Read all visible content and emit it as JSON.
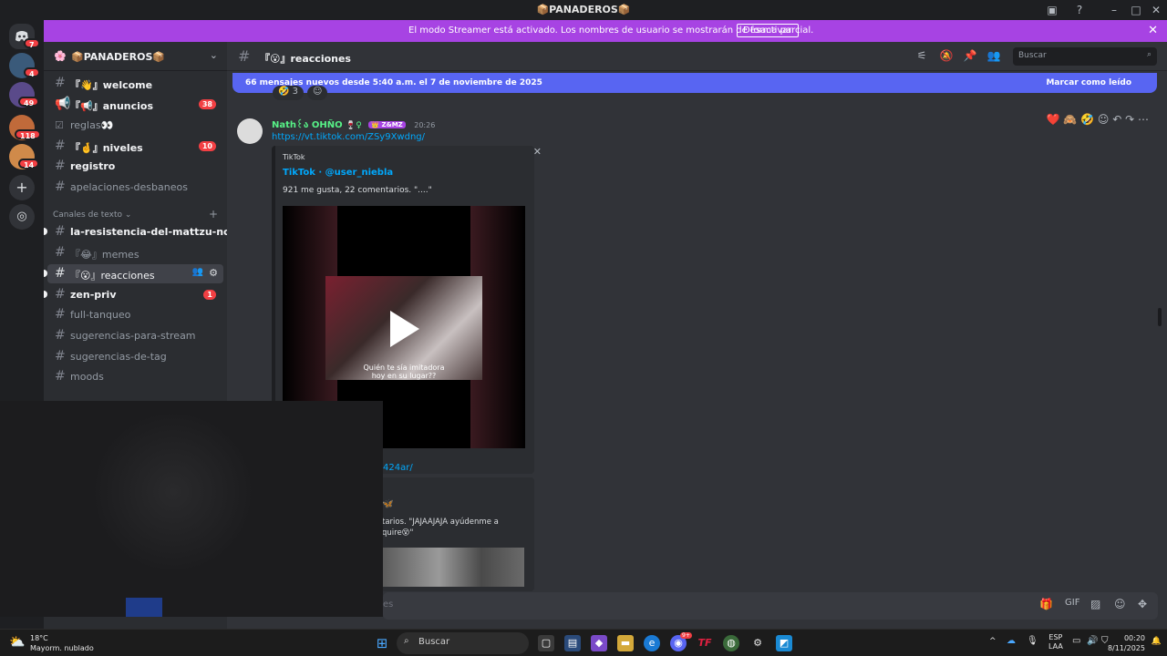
{
  "window": {
    "title": "📦PANADEROS📦"
  },
  "banner": {
    "text": "El modo Streamer está activado. Los nombres de usuario se mostrarán de forma parcial.",
    "button": "Desactivar"
  },
  "rail": {
    "badges": [
      "7",
      "4",
      "49",
      "118",
      "14"
    ]
  },
  "server": {
    "name": "📦PANADEROS📦"
  },
  "channels": [
    {
      "label": "『👋』welcome",
      "unread": true,
      "count": ""
    },
    {
      "label": "『📢』anuncios",
      "unread": true,
      "count": "38"
    },
    {
      "label": "reglas👀",
      "unread": false,
      "count": ""
    },
    {
      "label": "『🤞』niveles",
      "unread": true,
      "count": "10"
    },
    {
      "label": "registro",
      "unread": true,
      "count": ""
    },
    {
      "label": "apelaciones-desbaneos",
      "unread": false,
      "count": ""
    }
  ],
  "category": {
    "label": "Canales de texto"
  },
  "text_channels": [
    {
      "label": "la-resistencia-del-mattzu-no-s...",
      "unread": true,
      "count": ""
    },
    {
      "label": "『😂』memes",
      "unread": false,
      "count": ""
    },
    {
      "label": "『😮』reacciones",
      "unread": false,
      "count": "",
      "active": true
    },
    {
      "label": "zen-priv",
      "unread": true,
      "count": "1"
    },
    {
      "label": "full-tanqueo",
      "unread": false,
      "count": ""
    },
    {
      "label": "sugerencias-para-stream",
      "unread": false,
      "count": ""
    },
    {
      "label": "sugerencias-de-tag",
      "unread": false,
      "count": ""
    },
    {
      "label": "moods",
      "unread": false,
      "count": ""
    }
  ],
  "chat": {
    "channel_name": "『😮』reacciones",
    "search_placeholder": "Buscar",
    "new_messages": "66 mensajes nuevos desde 5:40 a.m. el 7 de noviembre de 2025",
    "mark_read": "Marcar como leído",
    "reaction_count": "3",
    "message": {
      "author": "Nath꒰ა OHÑO",
      "tag": "Z&MZ",
      "time": "20:26",
      "link": "https://vt.tiktok.com/ZSy9Xwdng/",
      "embed_provider": "TikTok",
      "embed_title": "TikTok · @user_niebla",
      "embed_desc": "921 me gusta, 22 comentarios. \"....\"",
      "video_caption_1": "Quién te sía imitadora",
      "video_caption_2": "hoy en su lugar??"
    },
    "message2": {
      "link_tail": "424ar/",
      "desc_line1": "tarios. \"JAJAAJAJA ayúdenme a",
      "desc_line2": "quire😵\""
    },
    "composer_tail": "es"
  },
  "taskbar": {
    "temp": "18°C",
    "weather": "Mayorm. nublado",
    "search": "Buscar",
    "lang1": "ESP",
    "lang2": "LAA",
    "time": "00:20",
    "date": "8/11/2025",
    "discord_badge": "9+"
  }
}
